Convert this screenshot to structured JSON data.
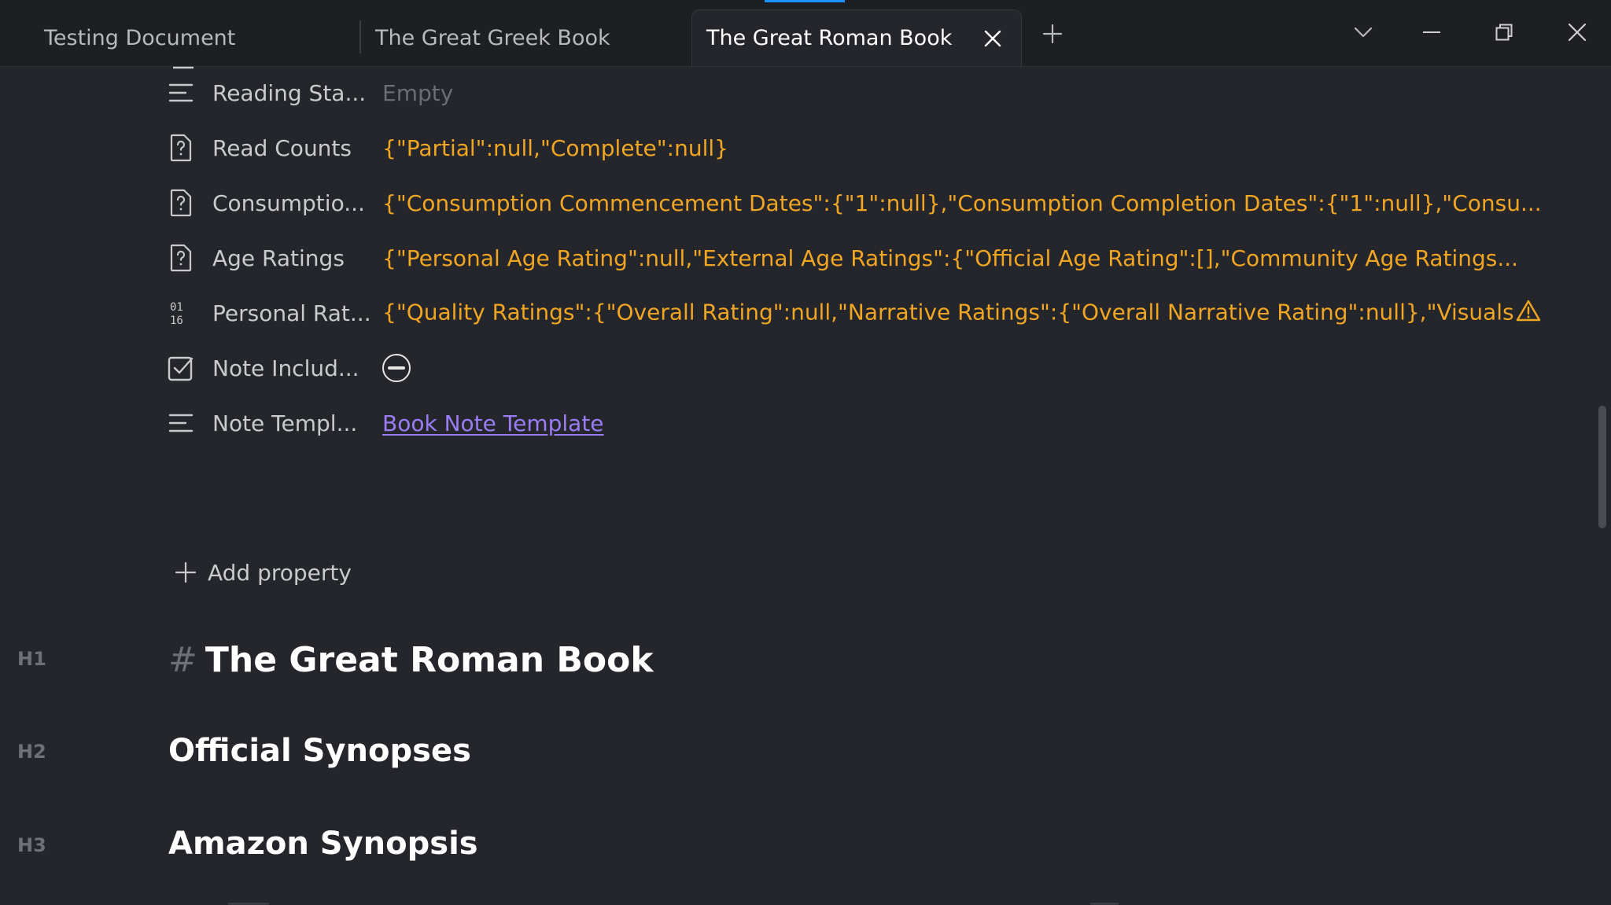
{
  "tabs": [
    {
      "label": "Testing Document",
      "active": false
    },
    {
      "label": "The Great Greek Book",
      "active": false
    },
    {
      "label": "The Great Roman Book",
      "active": true
    }
  ],
  "window_controls": [
    "chevron-down",
    "minimize",
    "restore",
    "close"
  ],
  "properties": [
    {
      "key": "Reading Sta...",
      "value": "Empty",
      "type": "text",
      "icon": "lines-icon"
    },
    {
      "key": "Read Counts",
      "value": "{\"Partial\":null,\"Complete\":null}",
      "type": "json",
      "icon": "unknown-type-icon"
    },
    {
      "key": "Consumptio...",
      "value": "{\"Consumption Commencement Dates\":{\"1\":null},\"Consumption Completion Dates\":{\"1\":null},\"Consu...",
      "type": "json",
      "icon": "unknown-type-icon"
    },
    {
      "key": "Age Ratings",
      "value": "{\"Personal Age Rating\":null,\"External Age Ratings\":{\"Official Age Rating\":[],\"Community Age Ratings...",
      "type": "json",
      "icon": "unknown-type-icon"
    },
    {
      "key": "Personal Rat...",
      "value": "{\"Quality Ratings\":{\"Overall Rating\":null,\"Narrative Ratings\":{\"Overall Narrative Rating\":null},\"Visuals",
      "type": "json-warning",
      "icon": "number-icon"
    },
    {
      "key": "Note Includ...",
      "value": "",
      "type": "checkbox-indeterminate",
      "icon": "checkbox-icon"
    },
    {
      "key": "Note Templ...",
      "value": "Book Note Template",
      "type": "link",
      "icon": "lines-icon"
    }
  ],
  "add_property_label": "Add property",
  "headings": [
    {
      "level": "H1",
      "marker": "#",
      "text": "The Great Roman Book"
    },
    {
      "level": "H2",
      "text": "Official Synopses"
    },
    {
      "level": "H3",
      "text": "Amazon Synopsis"
    }
  ],
  "colors": {
    "background": "#25262b",
    "tabbar": "#1e1f23",
    "json_value": "#f0a623",
    "link": "#9a7cf5",
    "empty": "#6b6d73",
    "accent": "#1e90ff"
  }
}
